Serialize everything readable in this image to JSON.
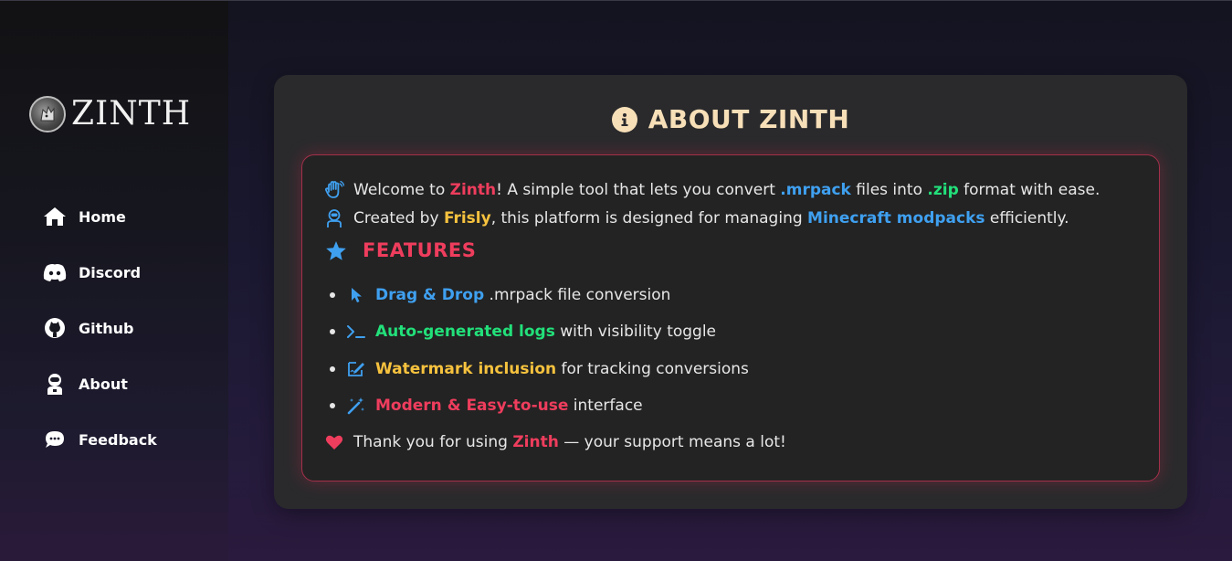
{
  "brand": {
    "name": "ZINTH"
  },
  "sidebar": {
    "items": [
      {
        "label": "Home",
        "icon": "home-icon"
      },
      {
        "label": "Discord",
        "icon": "discord-icon"
      },
      {
        "label": "Github",
        "icon": "github-icon"
      },
      {
        "label": "About",
        "icon": "astronaut-icon"
      },
      {
        "label": "Feedback",
        "icon": "comment-icon"
      }
    ]
  },
  "about": {
    "title": "ABOUT ZINTH",
    "welcome": {
      "p1": "Welcome to ",
      "name": "Zinth",
      "p2": "! A simple tool that lets you convert ",
      "ext1": ".mrpack",
      "p3": " files into ",
      "ext2": ".zip",
      "p4": " format with ease."
    },
    "created": {
      "p1": "Created by ",
      "author": "Frisly",
      "p2": ", this platform is designed for managing ",
      "topic": "Minecraft modpacks",
      "p3": " efficiently."
    },
    "features_heading": "FEATURES",
    "features": [
      {
        "highlight": "Drag & Drop",
        "rest": " .mrpack file conversion",
        "icon": "pointer-icon"
      },
      {
        "highlight": "Auto-generated logs",
        "rest": " with visibility toggle",
        "icon": "terminal-icon"
      },
      {
        "highlight": "Watermark inclusion",
        "rest": " for tracking conversions",
        "icon": "signature-icon"
      },
      {
        "highlight": "Modern & Easy-to-use",
        "rest": " interface",
        "icon": "magic-wand-icon"
      }
    ],
    "thanks": {
      "p1": "Thank you for using ",
      "name": "Zinth",
      "p2": " — your support means a lot!"
    }
  },
  "colors": {
    "accent_red": "#ef3d5d",
    "accent_blue": "#3fa0f0",
    "accent_green": "#22e07a",
    "accent_yellow": "#f6c23e",
    "title_cream": "#f7dfb8"
  }
}
